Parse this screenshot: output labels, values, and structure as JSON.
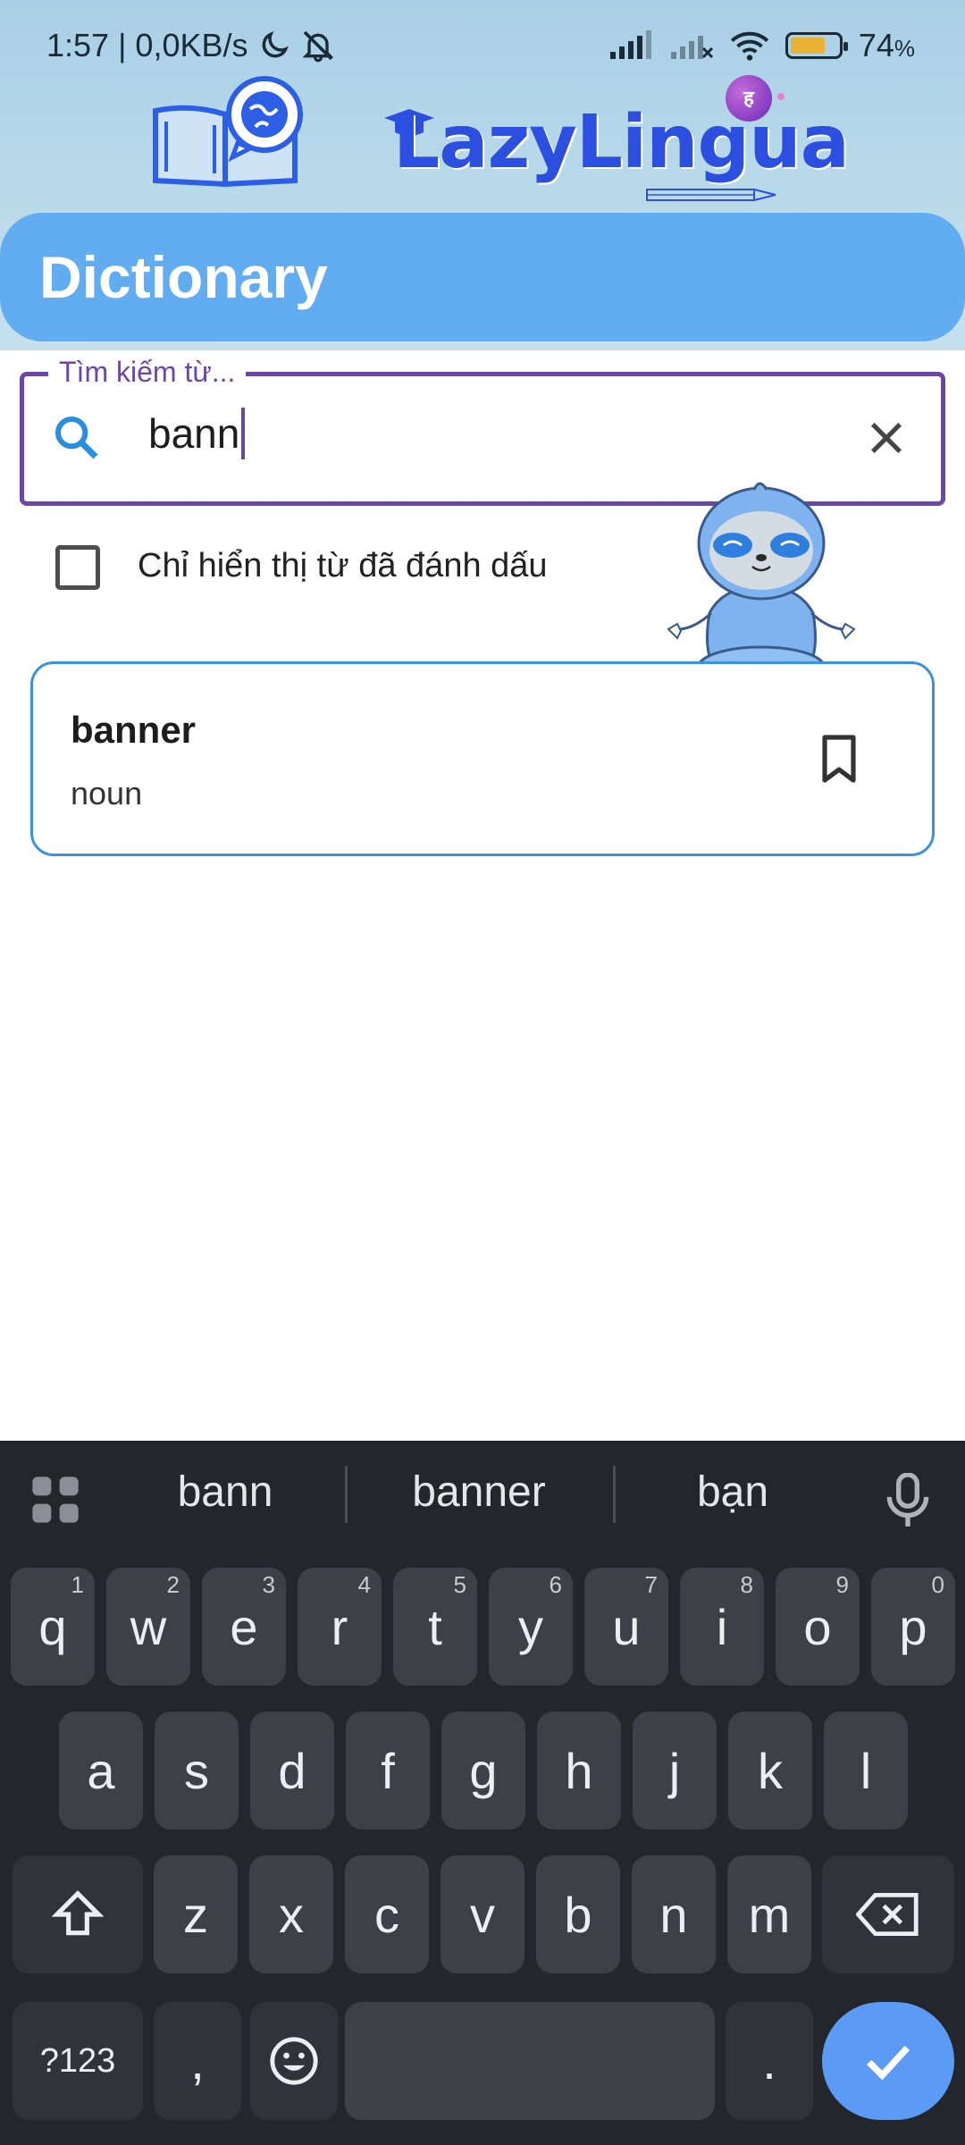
{
  "status_bar": {
    "time_info": "1:57 | 0,0KB/s",
    "battery_percent": "74",
    "battery_suffix": "%",
    "battery_level": 0.74,
    "icons": [
      "moon-icon",
      "muted-bell-icon",
      "signal-icon",
      "signal-no-sim-icon",
      "wifi-icon",
      "battery-icon"
    ]
  },
  "app": {
    "brand_name": "LazyLingua",
    "badge_text": "ह",
    "page_title": "Dictionary",
    "colors": {
      "title_bar": "#62acf1",
      "accent": "#6c46a8",
      "card_border": "#3b92e2",
      "brand": "#2c4fe0"
    }
  },
  "search": {
    "label": "Tìm kiếm từ...",
    "value": "bann"
  },
  "filter": {
    "checkbox_label": "Chỉ hiển thị từ đã đánh dấu",
    "checked": false
  },
  "results": [
    {
      "word": "banner",
      "part_of_speech": "noun",
      "bookmarked": false
    }
  ],
  "keyboard": {
    "suggestions": [
      "bann",
      "banner",
      "bạn"
    ],
    "row1": [
      {
        "k": "q",
        "n": "1"
      },
      {
        "k": "w",
        "n": "2"
      },
      {
        "k": "e",
        "n": "3"
      },
      {
        "k": "r",
        "n": "4"
      },
      {
        "k": "t",
        "n": "5"
      },
      {
        "k": "y",
        "n": "6"
      },
      {
        "k": "u",
        "n": "7"
      },
      {
        "k": "i",
        "n": "8"
      },
      {
        "k": "o",
        "n": "9"
      },
      {
        "k": "p",
        "n": "0"
      }
    ],
    "row2": [
      "a",
      "s",
      "d",
      "f",
      "g",
      "h",
      "j",
      "k",
      "l"
    ],
    "row3": [
      "z",
      "x",
      "c",
      "v",
      "b",
      "n",
      "m"
    ],
    "symbols_label": "?123",
    "comma_label": ",",
    "period_label": ".",
    "space_label": ""
  }
}
